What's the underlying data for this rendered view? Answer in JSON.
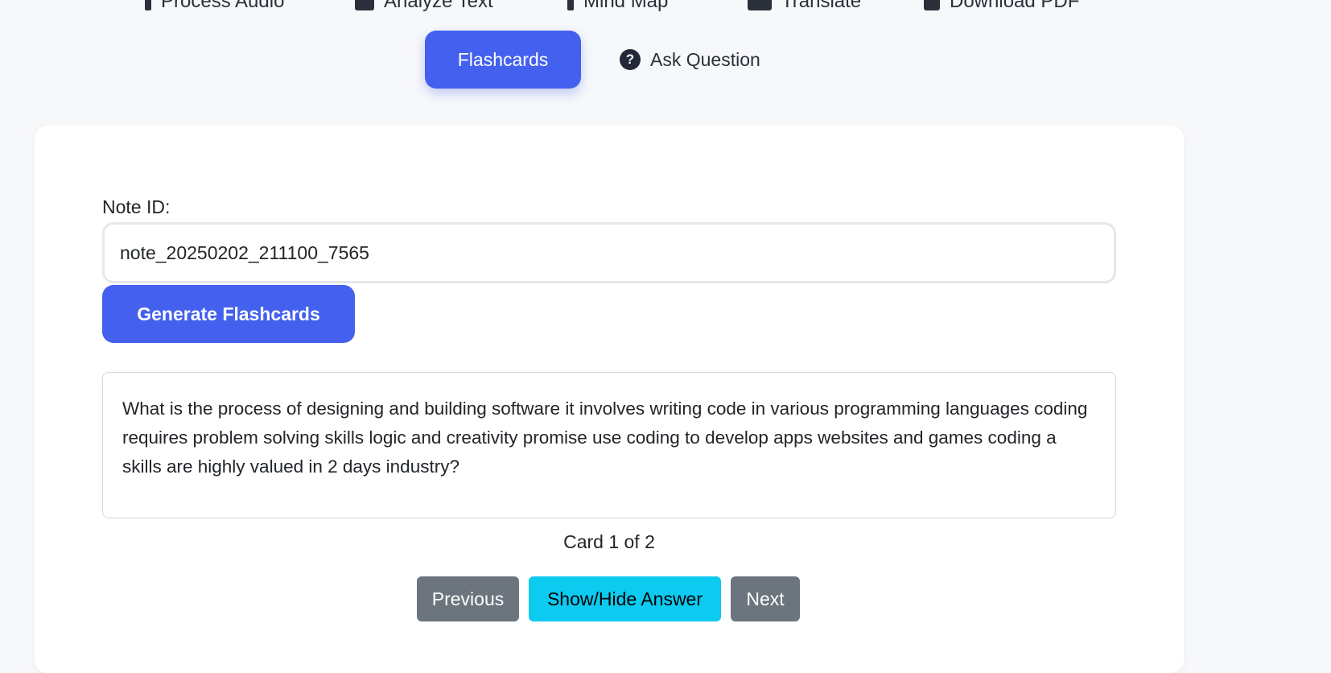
{
  "nav": {
    "items": [
      {
        "label": "Process Audio",
        "icon": "microphone-icon"
      },
      {
        "label": "Analyze Text",
        "icon": "text-icon"
      },
      {
        "label": "Mind Map",
        "icon": "mind-map-icon"
      },
      {
        "label": "Translate",
        "icon": "translate-icon"
      },
      {
        "label": "Download PDF",
        "icon": "pdf-icon"
      }
    ]
  },
  "tabs": {
    "flashcards": "Flashcards",
    "ask_question": "Ask Question",
    "ask_icon": "question-circle-icon"
  },
  "form": {
    "note_label": "Note ID:",
    "note_value": "note_20250202_211100_7565",
    "generate_label": "Generate Flashcards"
  },
  "card": {
    "text": "What is the process of designing and building software it involves writing code in various programming languages coding requires problem solving skills logic and creativity promise use coding to develop apps websites and games coding a skills are highly valued in 2 days industry?",
    "counter": "Card 1 of 2"
  },
  "controls": {
    "previous": "Previous",
    "toggle_answer": "Show/Hide Answer",
    "next": "Next"
  },
  "colors": {
    "primary": "#4361ee",
    "info": "#0dcaf0",
    "secondary": "#6c757d",
    "background": "#f7f8fa"
  }
}
